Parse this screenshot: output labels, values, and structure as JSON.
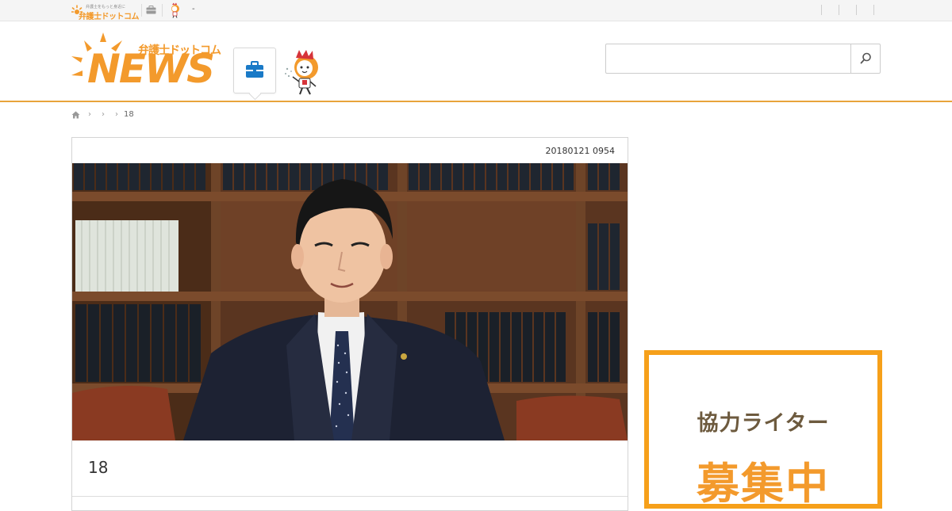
{
  "topbar": {
    "logo_tagline": "弁護士をもっと身近に",
    "logo_name": "弁護士ドットコム",
    "mascot_sep_text": "-",
    "right_separators": 4
  },
  "header": {
    "logo_jp": "弁護士ドットコム",
    "logo_en": "NEWS",
    "search": {
      "value": "",
      "placeholder": ""
    }
  },
  "breadcrumb": {
    "current": "18"
  },
  "article": {
    "date": "20180121 0954",
    "title": "18"
  },
  "ad": {
    "line1": "協力ライター",
    "line2": "募集中"
  },
  "colors": {
    "brand_orange": "#f39a2c",
    "header_border": "#e8a33b",
    "ad_border": "#f6a01a",
    "toolbox_blue": "#1a7ac7"
  },
  "icons": [
    "home-icon",
    "chevron-right-icon",
    "toolbox-icon",
    "search-icon",
    "mascot-icon"
  ]
}
